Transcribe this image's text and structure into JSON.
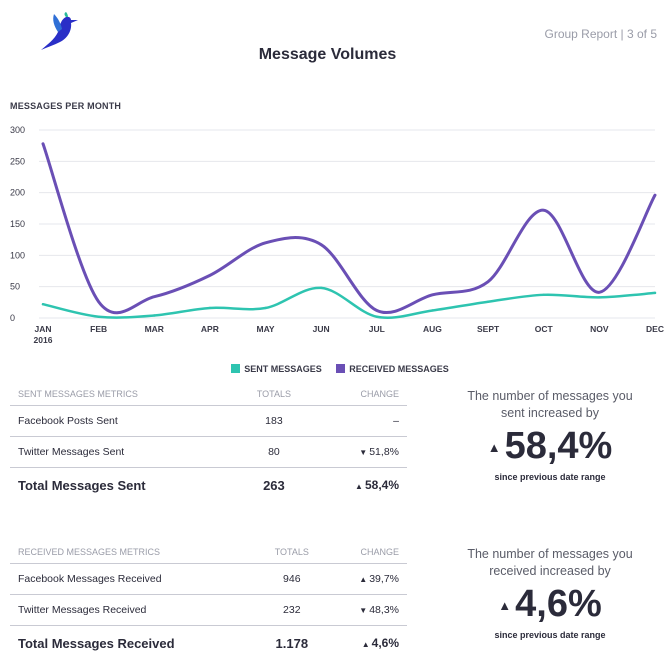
{
  "header": {
    "report_tag": "Group Report | 3 of 5",
    "title": "Message Volumes"
  },
  "chart_data": {
    "type": "line",
    "subtitle": "MESSAGES PER MONTH",
    "categories": [
      "JAN",
      "FEB",
      "MAR",
      "APR",
      "MAY",
      "JUN",
      "JUL",
      "AUG",
      "SEPT",
      "OCT",
      "NOV",
      "DEC"
    ],
    "first_category_sublabel": "2016",
    "ylim": [
      0,
      300
    ],
    "yticks": [
      0,
      50,
      100,
      150,
      200,
      250,
      300
    ],
    "grid": true,
    "legend_position": "bottom",
    "series": [
      {
        "name": "SENT MESSAGES",
        "color": "#2ec4b0",
        "values": [
          22,
          2,
          4,
          16,
          16,
          48,
          2,
          12,
          26,
          37,
          33,
          40
        ]
      },
      {
        "name": "RECEIVED MESSAGES",
        "color": "#6a4fb5",
        "values": [
          278,
          26,
          34,
          68,
          120,
          117,
          12,
          37,
          58,
          172,
          41,
          196
        ]
      }
    ]
  },
  "sent_metrics": {
    "header": {
      "label": "SENT MESSAGES METRICS",
      "totals": "TOTALS",
      "change": "CHANGE"
    },
    "rows": [
      {
        "label": "Facebook Posts Sent",
        "total": "183",
        "change": "–",
        "direction": ""
      },
      {
        "label": "Twitter Messages Sent",
        "total": "80",
        "change": "51,8%",
        "direction": "down"
      }
    ],
    "total": {
      "label": "Total Messages Sent",
      "total": "263",
      "change": "58,4%",
      "direction": "up"
    }
  },
  "received_metrics": {
    "header": {
      "label": "RECEIVED MESSAGES METRICS",
      "totals": "TOTALS",
      "change": "CHANGE"
    },
    "rows": [
      {
        "label": "Facebook Messages Received",
        "total": "946",
        "change": "39,7%",
        "direction": "up"
      },
      {
        "label": "Twitter Messages Received",
        "total": "232",
        "change": "48,3%",
        "direction": "down"
      }
    ],
    "total": {
      "label": "Total Messages Received",
      "total": "1.178",
      "change": "4,6%",
      "direction": "up"
    }
  },
  "sent_summary": {
    "line1": "The number of messages you",
    "line2": "sent increased by",
    "value": "58,4%",
    "since": "since previous date range"
  },
  "received_summary": {
    "line1": "The number of messages you",
    "line2": "received increased by",
    "value": "4,6%",
    "since": "since previous date range"
  },
  "icons": {
    "logo": "bird-logo-icon",
    "up": "triangle-up-icon",
    "down": "triangle-down-icon"
  },
  "colors": {
    "accent_purple": "#6a4fb5",
    "accent_teal": "#2ec4b0",
    "logo_blue": "#2a2fc7"
  }
}
